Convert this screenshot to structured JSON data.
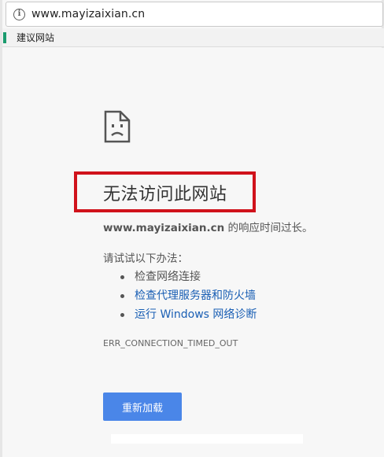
{
  "browser": {
    "url": "www.mayizaixian.cn",
    "info_icon": "info-icon",
    "bookmarks": [
      {
        "label": "建议网站"
      }
    ]
  },
  "error_page": {
    "icon": "sad-document-icon",
    "title": "无法访问此网站",
    "domain": "www.mayizaixian.cn",
    "description_suffix": " 的响应时间过长。",
    "try_label": "请试试以下办法：",
    "suggestions": [
      {
        "text": "检查网络连接",
        "is_link": false
      },
      {
        "text": "检查代理服务器和防火墙",
        "is_link": true
      },
      {
        "text": "运行 Windows 网络诊断",
        "is_link": true
      }
    ],
    "error_code": "ERR_CONNECTION_TIMED_OUT",
    "reload_button": "重新加载"
  },
  "colors": {
    "highlight_box": "#d0121b",
    "link": "#1a5fb4",
    "button": "#4a86e8"
  }
}
